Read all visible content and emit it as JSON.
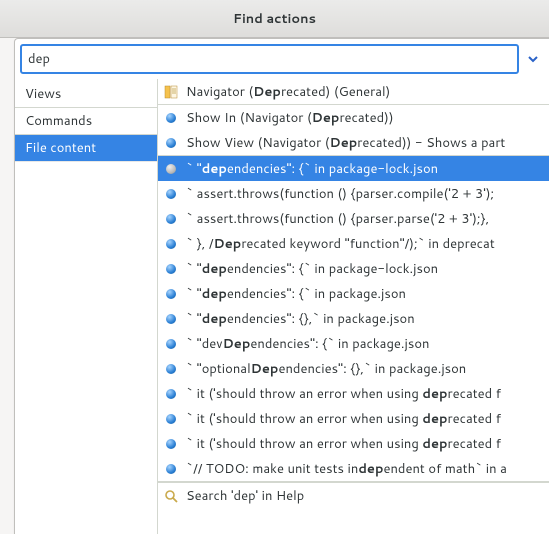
{
  "title": "Find actions",
  "search": {
    "value": "dep"
  },
  "sidebar": {
    "items": [
      {
        "label": "Views"
      },
      {
        "label": "Commands"
      },
      {
        "label": "File content",
        "selected": true
      }
    ]
  },
  "results": [
    {
      "icon": "navigator",
      "parts": [
        "Navigator (",
        "Dep",
        "recated) (General)"
      ],
      "section": "views"
    },
    {
      "icon": "blue",
      "parts": [
        "Show In (Navigator (",
        "Dep",
        "recated))"
      ],
      "section": "commands"
    },
    {
      "icon": "blue",
      "parts": [
        "Show View (Navigator (",
        "Dep",
        "recated)) - Shows a part"
      ],
      "section": "commands"
    },
    {
      "icon": "ring",
      "parts": [
        "`    \"",
        "dep",
        "endencies\": {` in package-lock.json"
      ],
      "selected": true,
      "section": "file"
    },
    {
      "icon": "blue",
      "parts": [
        "`    assert.throws(function () {parser.compile('2 + 3');"
      ],
      "section": "file"
    },
    {
      "icon": "blue",
      "parts": [
        "`    assert.throws(function () {parser.parse('2 + 3');},"
      ],
      "section": "file"
    },
    {
      "icon": "blue",
      "parts": [
        "`  }, /",
        "Dep",
        "recated keyword \"function\"/);` in deprecat"
      ],
      "section": "file"
    },
    {
      "icon": "blue",
      "parts": [
        "` \"",
        "dep",
        "endencies\": {` in package-lock.json"
      ],
      "section": "file"
    },
    {
      "icon": "blue",
      "parts": [
        "` \"",
        "dep",
        "endencies\": {` in package.json"
      ],
      "section": "file"
    },
    {
      "icon": "blue",
      "parts": [
        "` \"",
        "dep",
        "endencies\": {},` in package.json"
      ],
      "section": "file"
    },
    {
      "icon": "blue",
      "parts": [
        "` \"dev",
        "Dep",
        "endencies\": {` in package.json"
      ],
      "section": "file"
    },
    {
      "icon": "blue",
      "parts": [
        "` \"optional",
        "Dep",
        "endencies\": {},` in package.json"
      ],
      "section": "file"
    },
    {
      "icon": "blue",
      "parts": [
        "`  it ('should throw an error when using ",
        "dep",
        "recated f"
      ],
      "section": "file"
    },
    {
      "icon": "blue",
      "parts": [
        "`  it ('should throw an error when using ",
        "dep",
        "recated f"
      ],
      "section": "file"
    },
    {
      "icon": "blue",
      "parts": [
        "`  it ('should throw an error when using ",
        "dep",
        "recated f"
      ],
      "section": "file"
    },
    {
      "icon": "blue",
      "parts": [
        "`// TODO: make unit tests in",
        "dep",
        "endent of math` in a"
      ],
      "section": "file"
    },
    {
      "icon": "help",
      "parts": [
        "Search 'dep' in Help"
      ],
      "section": "help"
    }
  ]
}
